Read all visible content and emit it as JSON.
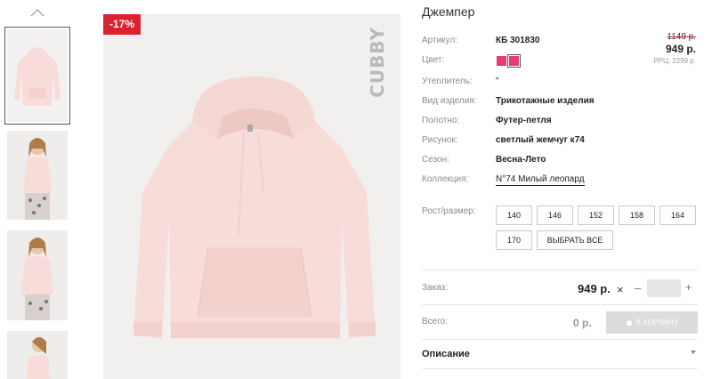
{
  "product": {
    "title": "Джемпер",
    "discount_badge": "-17%",
    "brand": "CUBBY",
    "old_price": "1149 р.",
    "price": "949 р.",
    "rrc": "РРЦ: 2299 р."
  },
  "attributes": {
    "article_label": "Артикул:",
    "article_value": "КБ 301830",
    "color_label": "Цвет:",
    "insulation_label": "Утеплитель:",
    "insulation_value": "\"",
    "type_label": "Вид изделия:",
    "type_value": "Трикотажные изделия",
    "fabric_label": "Полотно:",
    "fabric_value": "Футер-петля",
    "pattern_label": "Рисунок:",
    "pattern_value": "светлый жемчуг к74",
    "season_label": "Сезон:",
    "season_value": "Весна-Лето",
    "collection_label": "Коллекция:",
    "collection_value": "N°74 Милый леопард"
  },
  "colors": {
    "swatch_1": "#e73b73",
    "swatch_2": "#e73b73"
  },
  "sizes": {
    "label": "Рост/размер:",
    "options": [
      "140",
      "146",
      "152",
      "158",
      "164",
      "170"
    ],
    "select_all": "ВЫБРАТЬ ВСЕ"
  },
  "order": {
    "label": "Заказ:",
    "price": "949 р.",
    "quantity": "",
    "minus": "–",
    "plus": "+",
    "times": "×"
  },
  "total": {
    "label": "Всего:",
    "value": "0 р.",
    "cart_button": "В КОРЗИНУ"
  },
  "description": {
    "label": "Описание"
  },
  "theme": {
    "accent_red": "#d9232e",
    "garment_pink": "#f7dcd9"
  }
}
